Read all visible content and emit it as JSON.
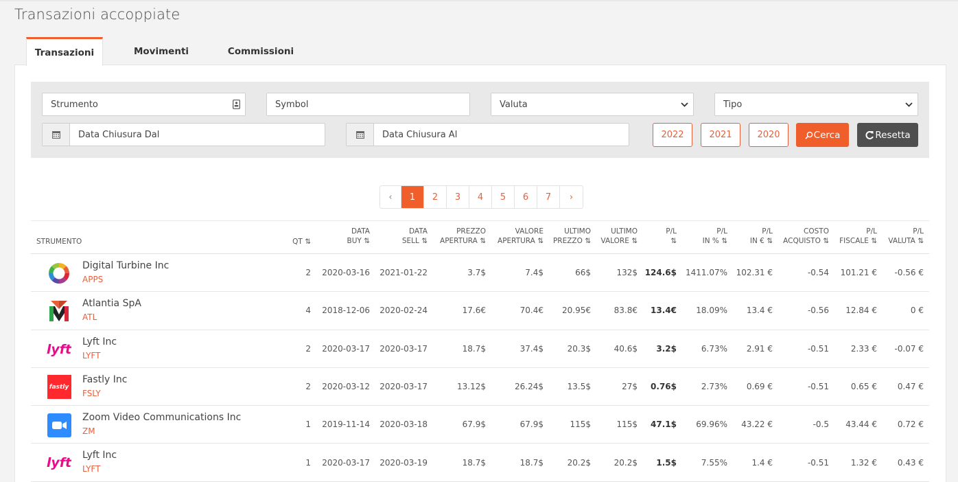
{
  "page": {
    "title": "Transazioni accoppiate"
  },
  "tabs": [
    {
      "label": "Transazioni",
      "active": true
    },
    {
      "label": "Movimenti"
    },
    {
      "label": "Commissioni"
    }
  ],
  "filters": {
    "strumento": "Strumento",
    "symbol": "Symbol",
    "valuta": "Valuta",
    "tipo": "Tipo",
    "data_dal": "Data Chiusura Dal",
    "data_al": "Data Chiusura Al",
    "years": [
      "2022",
      "2021",
      "2020"
    ],
    "cerca": "Cerca",
    "resetta": "Resetta"
  },
  "pagination": {
    "prev": "‹",
    "next": "›",
    "pages": [
      "1",
      "2",
      "3",
      "4",
      "5",
      "6",
      "7"
    ],
    "current": "1"
  },
  "columns": {
    "strumento": "STRUMENTO",
    "qt": "QT ⇅",
    "data_buy": [
      "DATA",
      "BUY ⇅"
    ],
    "data_sell": [
      "DATA",
      "SELL ⇅"
    ],
    "prezzo_apertura": [
      "PREZZO",
      "APERTURA ⇅"
    ],
    "valore_apertura": [
      "VALORE",
      "APERTURA ⇅"
    ],
    "ultimo_prezzo": [
      "ULTIMO",
      "PREZZO ⇅"
    ],
    "ultimo_valore": [
      "ULTIMO",
      "VALORE ⇅"
    ],
    "pl": [
      "P/L",
      "⇅"
    ],
    "pl_pct": [
      "P/L",
      "IN % ⇅"
    ],
    "pl_eur": [
      "P/L",
      "IN € ⇅"
    ],
    "costo": [
      "COSTO",
      "ACQUISTO ⇅"
    ],
    "pl_fiscale": [
      "P/L",
      "FISCALE ⇅"
    ],
    "pl_valuta": [
      "P/L",
      "VALUTA ⇅"
    ]
  },
  "rows": [
    {
      "name": "Digital Turbine Inc",
      "symbol": "APPS",
      "logo": "digital-turbine-logo",
      "qt": "2",
      "buy": "2020-03-16",
      "sell": "2021-01-22",
      "prezzo": "3.7$",
      "valore": "7.4$",
      "ultimo_prezzo": "66$",
      "ultimo_valore": "132$",
      "pl": "124.6$",
      "pl_pct": "1411.07%",
      "pl_eur": "102.31 €",
      "costo": "-0.54",
      "fiscale": "101.21 €",
      "valuta": "-0.56 €"
    },
    {
      "name": "Atlantia SpA",
      "symbol": "ATL",
      "logo": "atlantia-logo",
      "qt": "4",
      "buy": "2018-12-06",
      "sell": "2020-02-24",
      "prezzo": "17.6€",
      "valore": "70.4€",
      "ultimo_prezzo": "20.95€",
      "ultimo_valore": "83.8€",
      "pl": "13.4€",
      "pl_pct": "18.09%",
      "pl_eur": "13.4 €",
      "costo": "-0.56",
      "fiscale": "12.84 €",
      "valuta": "0 €"
    },
    {
      "name": "Lyft Inc",
      "symbol": "LYFT",
      "logo": "lyft-logo",
      "qt": "2",
      "buy": "2020-03-17",
      "sell": "2020-03-17",
      "prezzo": "18.7$",
      "valore": "37.4$",
      "ultimo_prezzo": "20.3$",
      "ultimo_valore": "40.6$",
      "pl": "3.2$",
      "pl_pct": "6.73%",
      "pl_eur": "2.91 €",
      "costo": "-0.51",
      "fiscale": "2.33 €",
      "valuta": "-0.07 €"
    },
    {
      "name": "Fastly Inc",
      "symbol": "FSLY",
      "logo": "fastly-logo",
      "logo_text": "fastly",
      "qt": "2",
      "buy": "2020-03-12",
      "sell": "2020-03-17",
      "prezzo": "13.12$",
      "valore": "26.24$",
      "ultimo_prezzo": "13.5$",
      "ultimo_valore": "27$",
      "pl": "0.76$",
      "pl_pct": "2.73%",
      "pl_eur": "0.69 €",
      "costo": "-0.51",
      "fiscale": "0.65 €",
      "valuta": "0.47 €"
    },
    {
      "name": "Zoom Video Communications Inc",
      "symbol": "ZM",
      "logo": "zoom-logo",
      "qt": "1",
      "buy": "2019-11-14",
      "sell": "2020-03-18",
      "prezzo": "67.9$",
      "valore": "67.9$",
      "ultimo_prezzo": "115$",
      "ultimo_valore": "115$",
      "pl": "47.1$",
      "pl_pct": "69.96%",
      "pl_eur": "43.22 €",
      "costo": "-0.5",
      "fiscale": "43.44 €",
      "valuta": "0.72 €"
    },
    {
      "name": "Lyft Inc",
      "symbol": "LYFT",
      "logo": "lyft-logo",
      "qt": "1",
      "buy": "2020-03-17",
      "sell": "2020-03-19",
      "prezzo": "18.7$",
      "valore": "18.7$",
      "ultimo_prezzo": "20.2$",
      "ultimo_valore": "20.2$",
      "pl": "1.5$",
      "pl_pct": "7.55%",
      "pl_eur": "1.4 €",
      "costo": "-0.51",
      "fiscale": "1.32 €",
      "valuta": "0.43 €"
    }
  ]
}
